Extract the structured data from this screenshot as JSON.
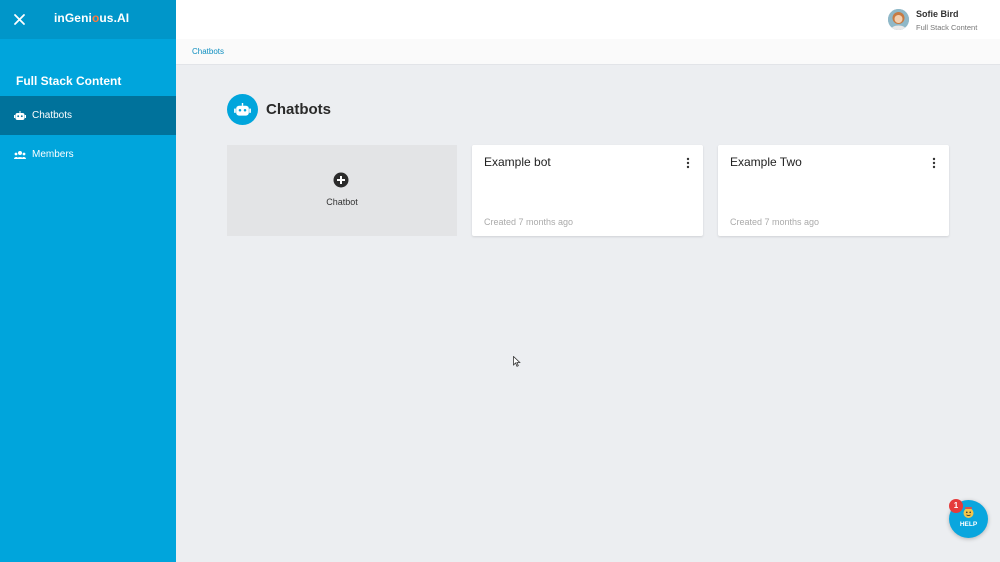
{
  "app": {
    "logo": "inGenious.AI",
    "logo_parts": [
      "inGeni",
      "o",
      "us.AI"
    ]
  },
  "sidebar": {
    "org_name": "Full Stack Content",
    "items": [
      {
        "label": "Chatbots",
        "icon": "robot-icon",
        "active": true
      },
      {
        "label": "Members",
        "icon": "members-icon",
        "active": false
      }
    ]
  },
  "user": {
    "name": "Sofie Bird",
    "org": "Full Stack Content"
  },
  "breadcrumb": [
    "Chatbots"
  ],
  "page": {
    "title": "Chatbots",
    "icon": "robot-icon"
  },
  "add_card": {
    "label": "Chatbot",
    "icon": "plus-circle-icon"
  },
  "bots": [
    {
      "name": "Example bot",
      "created": "Created 7 months ago"
    },
    {
      "name": "Example Two",
      "created": "Created 7 months ago"
    }
  ],
  "help": {
    "label": "HELP",
    "badge": "1"
  },
  "colors": {
    "sidebar": "#00a5dc",
    "sidebar_active": "#00729b",
    "accent": "#00a5dc",
    "background": "#eceef1",
    "badge": "#e53b3b"
  }
}
